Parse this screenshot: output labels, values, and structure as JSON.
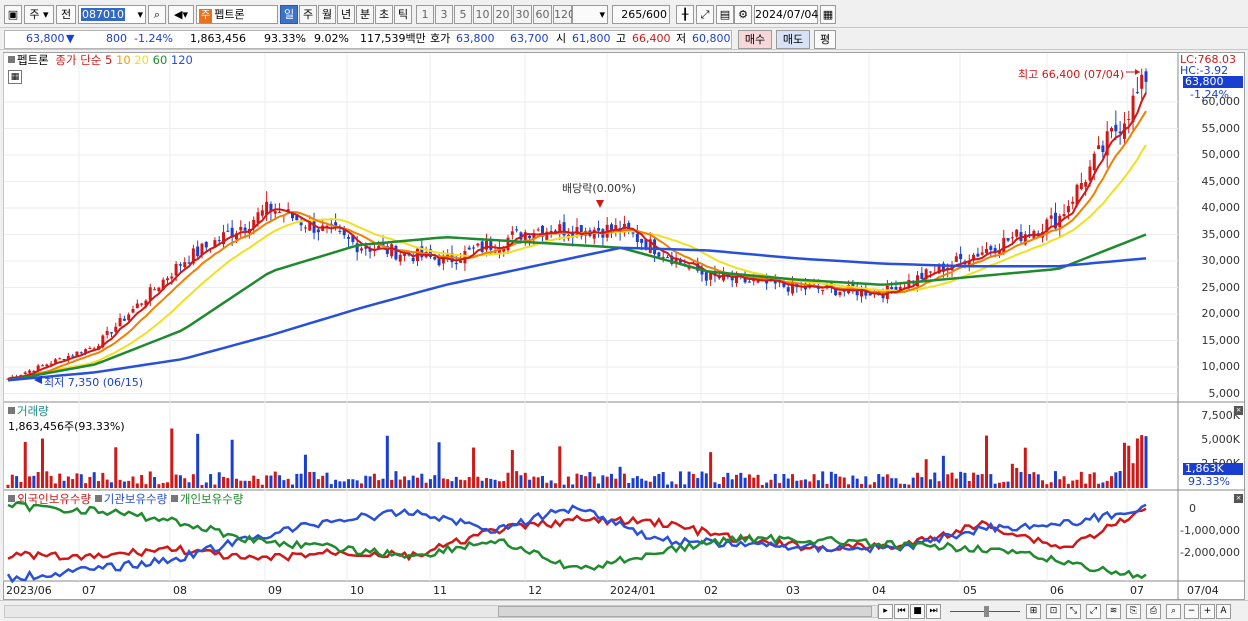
{
  "toolbar": {
    "market_type": "주",
    "prev_label": "전",
    "stock_code": "087010",
    "stock_prefix": "주",
    "stock_name": "펩트론",
    "periods": [
      "일",
      "주",
      "월",
      "년",
      "분",
      "초",
      "틱"
    ],
    "active_period": "일",
    "intervals": [
      "1",
      "3",
      "5",
      "10",
      "20",
      "30",
      "60",
      "120"
    ],
    "count_display": "265",
    "count_max": "/600",
    "date": "2024/07/04"
  },
  "quote": {
    "price": "63,800",
    "direction_symbol": "▼",
    "change": "800",
    "change_pct": "-1.24%",
    "volume": "1,863,456",
    "volume_ratio": "93.33%",
    "turnover": "9.02%",
    "amount": "117,539백만",
    "bid_ask_label": "호가",
    "ask": "63,800",
    "bid": "63,700",
    "open_label": "시",
    "open": "61,800",
    "high_label": "고",
    "high": "66,400",
    "low_label": "저",
    "low": "60,800",
    "buy_label": "매수",
    "sell_label": "매도",
    "eval_label": "평"
  },
  "price_panel": {
    "legend_name": "펩트론",
    "legend_ma_label": "종가 단순",
    "ma_periods": [
      {
        "period": "5",
        "color": "#d01818"
      },
      {
        "period": "10",
        "color": "#f0a000"
      },
      {
        "period": "20",
        "color": "#f0e020"
      },
      {
        "period": "60",
        "color": "#1f8a2e"
      },
      {
        "period": "120",
        "color": "#2850d8"
      }
    ],
    "lc_label": "LC:768.03",
    "hc_label": "HC:-3.92",
    "last_price_tag": "63,800",
    "last_change_tag": "-1.24%",
    "y_ticks": [
      "60,000",
      "55,000",
      "50,000",
      "45,000",
      "40,000",
      "35,000",
      "30,000",
      "25,000",
      "20,000",
      "15,000",
      "10,000",
      "5,000"
    ],
    "annotation_high": "최고 66,400 (07/04)",
    "annotation_low": "최저 7,350 (06/15)",
    "annotation_dividend": "배당락(0.00%)"
  },
  "volume_panel": {
    "title": "거래량",
    "value": "1,863,456주(93.33%)",
    "y_ticks": [
      "7,500K",
      "5,000K",
      "2,500K"
    ],
    "last_tag": "1,863K",
    "last_pct": "93.33%"
  },
  "holder_panel": {
    "series": [
      {
        "name": "외국인보유수량",
        "color": "#d01818"
      },
      {
        "name": "기관보유수량",
        "color": "#2850d8"
      },
      {
        "name": "개인보유수량",
        "color": "#1f8a2e"
      }
    ],
    "y_ticks": [
      "0",
      "-1,000,000",
      "-2,000,000"
    ]
  },
  "x_axis": {
    "labels": [
      "2023/06",
      "07",
      "08",
      "09",
      "10",
      "11",
      "12",
      "2024/01",
      "02",
      "03",
      "04",
      "05",
      "06",
      "07"
    ],
    "right_date": "07/04"
  },
  "chart_data": {
    "type": "line",
    "title": "펩트론",
    "ylabel": "",
    "ylim": [
      5000,
      68000
    ],
    "x": [
      "2023/06",
      "07",
      "08",
      "09",
      "10",
      "11",
      "12",
      "2024/01",
      "02",
      "03",
      "04",
      "05",
      "06",
      "07"
    ],
    "series": [
      {
        "name": "5",
        "values": [
          7800,
          14000,
          30000,
          40000,
          33000,
          30000,
          36000,
          36000,
          27000,
          25000,
          24000,
          31000,
          38000,
          63800
        ]
      },
      {
        "name": "60",
        "values": [
          7500,
          10500,
          17000,
          28000,
          33000,
          34500,
          33500,
          32500,
          28000,
          26500,
          25500,
          27000,
          28500,
          35000
        ]
      },
      {
        "name": "120",
        "values": [
          7500,
          9000,
          11500,
          16000,
          21000,
          25500,
          29000,
          32500,
          32000,
          30500,
          29500,
          29000,
          29000,
          30500
        ]
      }
    ],
    "high": {
      "value": 66400,
      "date": "07/04"
    },
    "low": {
      "value": 7350,
      "date": "06/15"
    },
    "legend": "top-left"
  },
  "colors": {
    "up": "#d01818",
    "down": "#1a3fd0",
    "ma5": "#d01818",
    "ma10": "#f08000",
    "ma20": "#f0e020",
    "ma60": "#1f8a2e",
    "ma120": "#2850d8",
    "accent": "#3c73c8"
  }
}
